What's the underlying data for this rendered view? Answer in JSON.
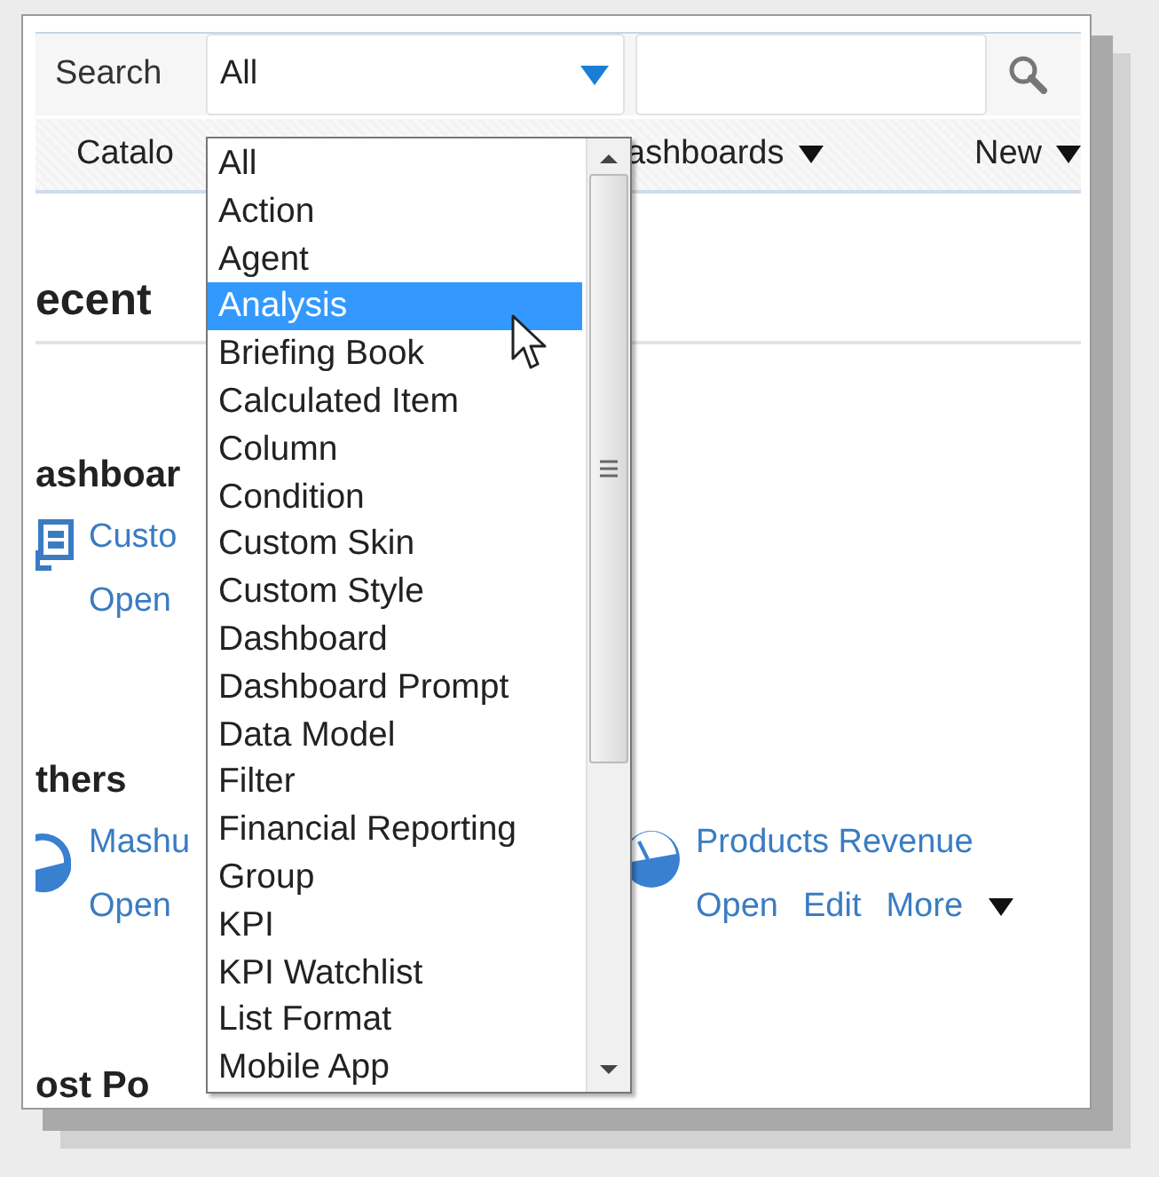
{
  "search": {
    "label": "Search",
    "scope": "All"
  },
  "nav": [
    {
      "label": "Catalo",
      "caret": false
    },
    {
      "label": "ashboards",
      "caret": true
    },
    {
      "label": "New",
      "caret": true
    }
  ],
  "sections": [
    {
      "heading": "ecent",
      "kind": "title"
    },
    {
      "heading": "ashboar",
      "kind": "group",
      "items": [
        {
          "kind": "dashboard",
          "title": "Custo",
          "actions": [
            "Open"
          ],
          "more": false
        }
      ]
    },
    {
      "heading": "thers",
      "kind": "group",
      "items": [
        {
          "kind": "mashup",
          "title": "Mashu",
          "actions": [
            "Open"
          ],
          "more": false
        },
        {
          "kind": "gauge",
          "title": "Products Revenue",
          "actions": [
            "Open",
            "Edit",
            "More"
          ],
          "more": true
        }
      ]
    },
    {
      "heading": "ost Po",
      "kind": "group"
    }
  ],
  "dropdown": {
    "options": [
      {
        "label": "All",
        "selected": false
      },
      {
        "label": "Action",
        "selected": false
      },
      {
        "label": "Agent",
        "selected": false
      },
      {
        "label": "Analysis",
        "selected": true
      },
      {
        "label": "Briefing Book",
        "selected": false
      },
      {
        "label": "Calculated Item",
        "selected": false
      },
      {
        "label": "Column",
        "selected": false
      },
      {
        "label": "Condition",
        "selected": false
      },
      {
        "label": "Custom Skin",
        "selected": false
      },
      {
        "label": "Custom Style",
        "selected": false
      },
      {
        "label": "Dashboard",
        "selected": false
      },
      {
        "label": "Dashboard Prompt",
        "selected": false
      },
      {
        "label": "Data Model",
        "selected": false
      },
      {
        "label": "Filter",
        "selected": false
      },
      {
        "label": "Financial Reporting",
        "selected": false
      },
      {
        "label": "Group",
        "selected": false
      },
      {
        "label": "KPI",
        "selected": false
      },
      {
        "label": "KPI Watchlist",
        "selected": false
      },
      {
        "label": "List Format",
        "selected": false
      },
      {
        "label": "Mobile App",
        "selected": false
      }
    ]
  }
}
